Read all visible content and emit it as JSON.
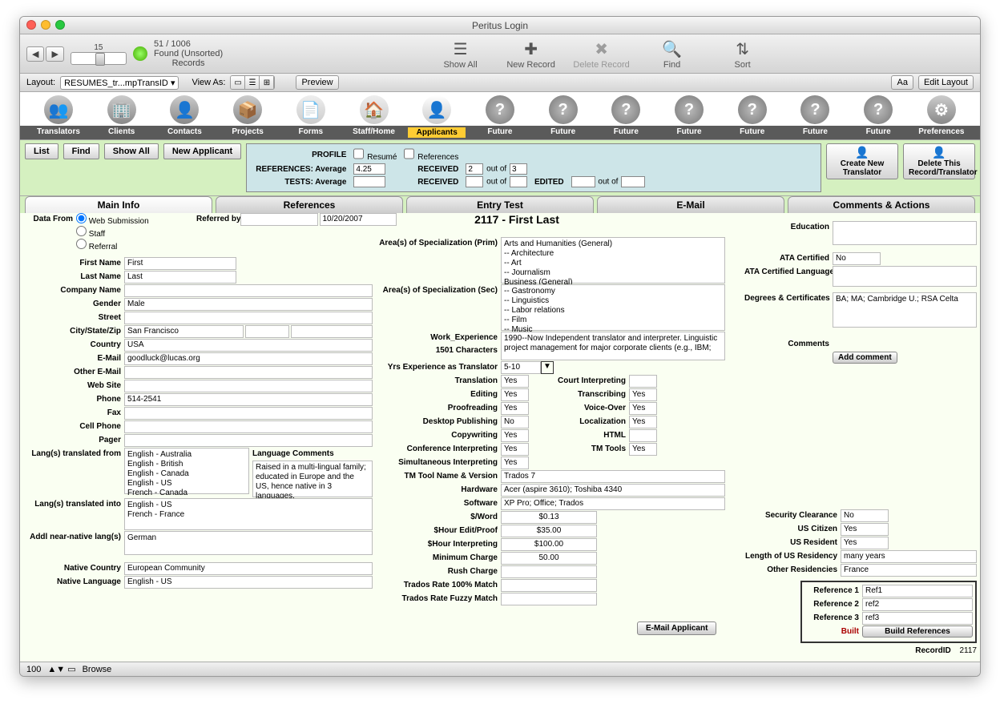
{
  "window_title": "Peritus Login",
  "record_nav": {
    "current": "15",
    "found": "51 / 1006",
    "status": "Found (Unsorted)",
    "records_label": "Records"
  },
  "toolbar_icons": {
    "show_all": "Show All",
    "new_record": "New Record",
    "delete_record": "Delete Record",
    "find": "Find",
    "sort": "Sort"
  },
  "layout_label": "Layout:",
  "layout_value": "RESUMES_tr...mpTransID",
  "viewas_label": "View As:",
  "preview_btn": "Preview",
  "edit_layout": "Edit Layout",
  "app_tabs": [
    "Translators",
    "Clients",
    "Contacts",
    "Projects",
    "Forms",
    "Staff/Home",
    "Applicants",
    "Future",
    "Future",
    "Future",
    "Future",
    "Future",
    "Future",
    "Future",
    "Preferences"
  ],
  "green_tabs": {
    "list": "List",
    "find": "Find",
    "show_all": "Show All",
    "new_applicant": "New Applicant"
  },
  "profile": {
    "profile_label": "PROFILE",
    "resume": "Resumé",
    "references": "References",
    "ref_avg_label": "REFERENCES: Average",
    "ref_avg": "4.25",
    "tests_avg_label": "TESTS: Average",
    "tests_avg": "",
    "received1_label": "RECEIVED",
    "received1": "2",
    "outof1": "out of",
    "outof1v": "3",
    "received2_label": "RECEIVED",
    "received2": "",
    "outof2": "out of",
    "outof2v": "",
    "edited_label": "EDITED",
    "edited": "",
    "editedoutof": "out of",
    "editedoutofv": ""
  },
  "action_btns": {
    "create": "Create New Translator",
    "delete": "Delete This Record/Translator"
  },
  "main_tabs": [
    "Main Info",
    "References",
    "Entry Test",
    "E-Mail",
    "Comments & Actions"
  ],
  "record_heading": "2117 - First Last",
  "data_from": {
    "label": "Data From",
    "opts": [
      "Web Submission",
      "Staff",
      "Referral"
    ],
    "selected": 0
  },
  "referred": {
    "label": "Referred by",
    "date": "10/20/2007"
  },
  "fields": {
    "first_name": {
      "label": "First Name",
      "value": "First"
    },
    "last_name": {
      "label": "Last Name",
      "value": "Last"
    },
    "company": {
      "label": "Company Name",
      "value": ""
    },
    "gender": {
      "label": "Gender",
      "value": "Male"
    },
    "street": {
      "label": "Street",
      "value": ""
    },
    "csz": {
      "label": "City/State/Zip",
      "city": "San Francisco",
      "state": "",
      "zip": ""
    },
    "country": {
      "label": "Country",
      "value": "USA"
    },
    "email": {
      "label": "E-Mail",
      "value": "goodluck@lucas.org"
    },
    "other_email": {
      "label": "Other E-Mail",
      "value": ""
    },
    "website": {
      "label": "Web Site",
      "value": ""
    },
    "phone": {
      "label": "Phone",
      "value": "514-2541"
    },
    "fax": {
      "label": "Fax",
      "value": ""
    },
    "cell": {
      "label": "Cell Phone",
      "value": ""
    },
    "pager": {
      "label": "Pager",
      "value": ""
    },
    "lang_from": {
      "label": "Lang(s) translated from",
      "value": "English - Australia\nEnglish - British\nEnglish - Canada\nEnglish - US\nFrench - Canada"
    },
    "lang_to": {
      "label": "Lang(s) translated into",
      "value": "English - US\nFrench - France"
    },
    "near_native": {
      "label": "Addl near-native lang(s)",
      "value": "German"
    },
    "native_country": {
      "label": "Native Country",
      "value": "European Community"
    },
    "native_lang": {
      "label": "Native Language",
      "value": "English - US"
    }
  },
  "lang_comments": {
    "label": "Language Comments",
    "value": "Raised in a multi-lingual family; educated in Europe and the US, hence native in 3 languages."
  },
  "spec_prim": {
    "label": "Area(s) of Specialization (Prim)",
    "value": "Arts and Humanities (General)\n-- Architecture\n-- Art\n-- Journalism\nBusiness (General)"
  },
  "spec_sec": {
    "label": "Area(s) of Specialization (Sec)",
    "value": "-- Gastronomy\n-- Linguistics\n-- Labor relations\n-- Film\n-- Music"
  },
  "work_exp": {
    "label": "Work_Experience",
    "sub": "1501 Characters",
    "value": "1990--Now   Independent translator and interpreter. Linguistic project management for major corporate clients (e.g., IBM;"
  },
  "yrs_exp": {
    "label": "Yrs Experience as Translator",
    "value": "5-10"
  },
  "skills": {
    "translation": {
      "label": "Translation",
      "value": "Yes"
    },
    "editing": {
      "label": "Editing",
      "value": "Yes"
    },
    "proofreading": {
      "label": "Proofreading",
      "value": "Yes"
    },
    "dtp": {
      "label": "Desktop Publishing",
      "value": "No"
    },
    "copywriting": {
      "label": "Copywriting",
      "value": "Yes"
    },
    "conf_interp": {
      "label": "Conference Interpreting",
      "value": "Yes"
    },
    "sim_interp": {
      "label": "Simultaneous Interpreting",
      "value": "Yes"
    },
    "court_interp": {
      "label": "Court Interpreting",
      "value": ""
    },
    "transcribing": {
      "label": "Transcribing",
      "value": "Yes"
    },
    "voiceover": {
      "label": "Voice-Over",
      "value": "Yes"
    },
    "localization": {
      "label": "Localization",
      "value": "Yes"
    },
    "html": {
      "label": "HTML",
      "value": ""
    },
    "tmtools": {
      "label": "TM Tools",
      "value": "Yes"
    }
  },
  "tm_tool": {
    "label": "TM Tool Name & Version",
    "value": "Trados 7"
  },
  "hardware": {
    "label": "Hardware",
    "value": "Acer (aspire 3610); Toshiba 4340"
  },
  "software": {
    "label": "Software",
    "value": "XP Pro; Office; Trados"
  },
  "rates": {
    "word": {
      "label": "$/Word",
      "value": "$0.13"
    },
    "edit": {
      "label": "$Hour Edit/Proof",
      "value": "$35.00"
    },
    "interp": {
      "label": "$Hour Interpreting",
      "value": "$100.00"
    },
    "min": {
      "label": "Minimum Charge",
      "value": "50.00"
    },
    "rush": {
      "label": "Rush Charge",
      "value": ""
    },
    "trados100": {
      "label": "Trados Rate 100% Match",
      "value": ""
    },
    "tradosfuzzy": {
      "label": "Trados Rate Fuzzy Match",
      "value": ""
    }
  },
  "right": {
    "education": {
      "label": "Education",
      "value": ""
    },
    "ata": {
      "label": "ATA Certified",
      "value": "No"
    },
    "ata_lang": {
      "label": "ATA Certified Language",
      "value": ""
    },
    "degrees": {
      "label": "Degrees & Certificates",
      "value": "BA; MA; Cambridge U.; RSA Celta"
    },
    "comments": {
      "label": "Comments",
      "add": "Add comment"
    },
    "sec_clear": {
      "label": "Security Clearance",
      "value": "No"
    },
    "us_cit": {
      "label": "US Citizen",
      "value": "Yes"
    },
    "us_res": {
      "label": "US Resident",
      "value": "Yes"
    },
    "us_len": {
      "label": "Length of US Residency",
      "value": "many years"
    },
    "other_res": {
      "label": "Other Residencies",
      "value": "France"
    }
  },
  "refs": {
    "r1": {
      "label": "Reference 1",
      "value": "Ref1"
    },
    "r2": {
      "label": "Reference 2",
      "value": "ref2"
    },
    "r3": {
      "label": "Reference 3",
      "value": "ref3"
    },
    "built": "Built",
    "build_btn": "Build References"
  },
  "email_applicant": "E-Mail Applicant",
  "record_id": {
    "label": "RecordID",
    "value": "2117"
  },
  "footer": {
    "zoom": "100",
    "mode": "Browse"
  }
}
